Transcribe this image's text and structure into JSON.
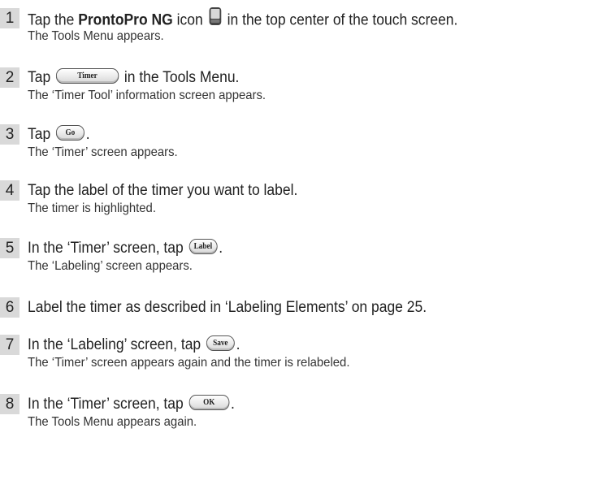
{
  "steps": [
    {
      "number": "1",
      "pre": "Tap the ",
      "bold": "ProntoPro NG",
      "mid": " icon ",
      "icon": "pronto-device-icon",
      "post": " in the top center of the touch screen.",
      "result": "The Tools Menu appears."
    },
    {
      "number": "2",
      "pre": "Tap ",
      "button": "Timer",
      "post": " in the Tools Menu.",
      "result": "The ‘Timer Tool’ information screen appears."
    },
    {
      "number": "3",
      "pre": "Tap ",
      "button": "Go",
      "post": ".",
      "result": "The ‘Timer’ screen appears."
    },
    {
      "number": "4",
      "text": "Tap the label of the timer you want to label.",
      "result": "The timer is highlighted."
    },
    {
      "number": "5",
      "pre": "In the ‘Timer’ screen, tap ",
      "button": "Label",
      "post": ".",
      "result": "The ‘Labeling’ screen appears."
    },
    {
      "number": "6",
      "text": "Label the timer as described in ‘Labeling Elements’ on page 25."
    },
    {
      "number": "7",
      "pre": "In the ‘Labeling’ screen, tap ",
      "button": "Save",
      "post": ".",
      "result": "The ‘Timer’ screen appears again and the timer is relabeled."
    },
    {
      "number": "8",
      "pre": "In the ‘Timer’ screen, tap ",
      "button": "OK",
      "post": ".",
      "result": "The Tools Menu appears again."
    }
  ]
}
